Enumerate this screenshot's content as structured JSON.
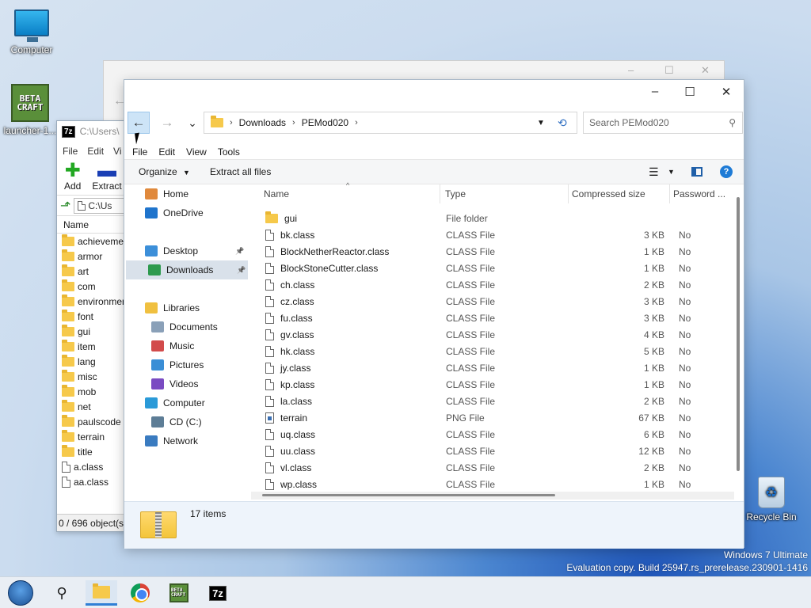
{
  "desktop": {
    "icons": [
      {
        "label": "Computer",
        "icon": "monitor-icon"
      },
      {
        "label": "launcher-1...",
        "icon": "betacraft-icon",
        "logo_text": "BETA CRAFT"
      },
      {
        "label": "Recycle Bin",
        "icon": "recycle-bin-icon"
      }
    ],
    "watermark": {
      "line1": "Windows 7 Ultimate",
      "line2": "Evaluation copy. Build 25947.rs_prerelease.230901-1416"
    }
  },
  "zip_window": {
    "title": "C:\\Users\\",
    "app_badge": "7z",
    "menu": [
      "File",
      "Edit",
      "Vi"
    ],
    "toolbar": {
      "add": "Add",
      "extract": "Extract"
    },
    "address": "C:\\Us",
    "column_name": "Name",
    "items": [
      {
        "name": "achievemen",
        "kind": "folder"
      },
      {
        "name": "armor",
        "kind": "folder"
      },
      {
        "name": "art",
        "kind": "folder"
      },
      {
        "name": "com",
        "kind": "folder"
      },
      {
        "name": "environmen",
        "kind": "folder"
      },
      {
        "name": "font",
        "kind": "folder"
      },
      {
        "name": "gui",
        "kind": "folder"
      },
      {
        "name": "item",
        "kind": "folder"
      },
      {
        "name": "lang",
        "kind": "folder"
      },
      {
        "name": "misc",
        "kind": "folder"
      },
      {
        "name": "mob",
        "kind": "folder"
      },
      {
        "name": "net",
        "kind": "folder"
      },
      {
        "name": "paulscode",
        "kind": "folder"
      },
      {
        "name": "terrain",
        "kind": "folder"
      },
      {
        "name": "title",
        "kind": "folder"
      },
      {
        "name": "a.class",
        "kind": "file"
      },
      {
        "name": "aa.class",
        "kind": "file"
      }
    ],
    "status": "0 / 696 object(s)"
  },
  "explorer": {
    "window_controls": {
      "minimize": "–",
      "maximize": "☐",
      "close": "✕"
    },
    "nav": {
      "back": "←",
      "forward": "→",
      "recent": "⌄",
      "refresh": "⟲"
    },
    "breadcrumb": [
      "Downloads",
      "PEMod020"
    ],
    "search_placeholder": "Search PEMod020",
    "menu": [
      "File",
      "Edit",
      "View",
      "Tools"
    ],
    "commands": {
      "organize": "Organize",
      "extract_all": "Extract all files"
    },
    "nav_pane": [
      {
        "label": "Home",
        "icon": "home-icon",
        "color": "#e0893c"
      },
      {
        "label": "OneDrive",
        "icon": "onedrive-icon",
        "color": "#1f74cc"
      },
      {
        "label": "Desktop",
        "icon": "desktop-icon",
        "color": "#3c8fd9",
        "pinned": true
      },
      {
        "label": "Downloads",
        "icon": "downloads-icon",
        "color": "#2e9a4e",
        "pinned": true,
        "selected": true
      },
      {
        "label": "Libraries",
        "icon": "libraries-icon",
        "color": "#f0c040"
      },
      {
        "label": "Documents",
        "icon": "documents-icon",
        "color": "#8aa0b8"
      },
      {
        "label": "Music",
        "icon": "music-icon",
        "color": "#d24b4b"
      },
      {
        "label": "Pictures",
        "icon": "pictures-icon",
        "color": "#3a8ed6"
      },
      {
        "label": "Videos",
        "icon": "videos-icon",
        "color": "#7a4bc2"
      },
      {
        "label": "Computer",
        "icon": "computer-icon",
        "color": "#2a9ad8"
      },
      {
        "label": "CD (C:)",
        "icon": "drive-icon",
        "color": "#5d7d96"
      },
      {
        "label": "Network",
        "icon": "network-icon",
        "color": "#3a7bc0"
      }
    ],
    "columns": {
      "name": "Name",
      "type": "Type",
      "size": "Compressed size",
      "password": "Password ..."
    },
    "files": [
      {
        "name": "gui",
        "type": "File folder",
        "size": "",
        "password": "",
        "kind": "folder"
      },
      {
        "name": "bk.class",
        "type": "CLASS File",
        "size": "3 KB",
        "password": "No",
        "kind": "file"
      },
      {
        "name": "BlockNetherReactor.class",
        "type": "CLASS File",
        "size": "1 KB",
        "password": "No",
        "kind": "file"
      },
      {
        "name": "BlockStoneCutter.class",
        "type": "CLASS File",
        "size": "1 KB",
        "password": "No",
        "kind": "file"
      },
      {
        "name": "ch.class",
        "type": "CLASS File",
        "size": "2 KB",
        "password": "No",
        "kind": "file"
      },
      {
        "name": "cz.class",
        "type": "CLASS File",
        "size": "3 KB",
        "password": "No",
        "kind": "file"
      },
      {
        "name": "fu.class",
        "type": "CLASS File",
        "size": "3 KB",
        "password": "No",
        "kind": "file"
      },
      {
        "name": "gv.class",
        "type": "CLASS File",
        "size": "4 KB",
        "password": "No",
        "kind": "file"
      },
      {
        "name": "hk.class",
        "type": "CLASS File",
        "size": "5 KB",
        "password": "No",
        "kind": "file"
      },
      {
        "name": "jy.class",
        "type": "CLASS File",
        "size": "1 KB",
        "password": "No",
        "kind": "file"
      },
      {
        "name": "kp.class",
        "type": "CLASS File",
        "size": "1 KB",
        "password": "No",
        "kind": "file"
      },
      {
        "name": "la.class",
        "type": "CLASS File",
        "size": "2 KB",
        "password": "No",
        "kind": "file"
      },
      {
        "name": "terrain",
        "type": "PNG File",
        "size": "67 KB",
        "password": "No",
        "kind": "image"
      },
      {
        "name": "uq.class",
        "type": "CLASS File",
        "size": "6 KB",
        "password": "No",
        "kind": "file"
      },
      {
        "name": "uu.class",
        "type": "CLASS File",
        "size": "12 KB",
        "password": "No",
        "kind": "file"
      },
      {
        "name": "vl.class",
        "type": "CLASS File",
        "size": "2 KB",
        "password": "No",
        "kind": "file"
      },
      {
        "name": "wp.class",
        "type": "CLASS File",
        "size": "1 KB",
        "password": "No",
        "kind": "file"
      }
    ],
    "status": "17 items"
  },
  "taskbar": {
    "items": [
      {
        "icon": "start-orb-icon"
      },
      {
        "icon": "search-icon"
      },
      {
        "icon": "file-explorer-icon",
        "active": true
      },
      {
        "icon": "chrome-icon"
      },
      {
        "icon": "betacraft-icon",
        "logo_text": "BETA CRAFT"
      },
      {
        "icon": "7zip-icon",
        "label": "7z"
      }
    ]
  }
}
